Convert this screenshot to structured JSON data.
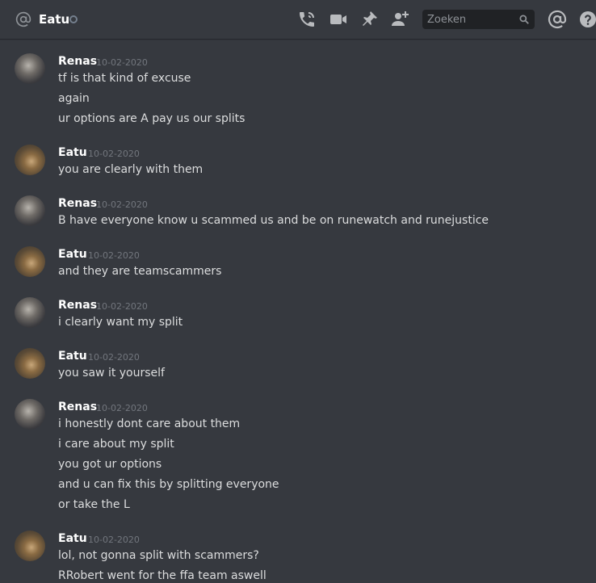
{
  "header": {
    "channel_name": "Eatu",
    "search_placeholder": "Zoeken",
    "colors": {
      "background": "#36393f",
      "text": "#dcddde",
      "muted": "#72767d",
      "icon": "#b9bbbe"
    },
    "icons": [
      "at-icon",
      "phone-icon",
      "video-icon",
      "pin-icon",
      "add-member-icon",
      "search-icon",
      "mention-icon",
      "help-icon"
    ]
  },
  "messages": [
    {
      "author": "Renas",
      "timestamp": "10-02-2020",
      "lines": [
        "tf is that kind of excuse",
        "again",
        "ur options are A pay us our splits"
      ]
    },
    {
      "author": "Eatu",
      "timestamp": "10-02-2020",
      "lines": [
        "you are clearly with them"
      ]
    },
    {
      "author": "Renas",
      "timestamp": "10-02-2020",
      "lines": [
        "B have everyone know u scammed us and be on runewatch and runejustice"
      ]
    },
    {
      "author": "Eatu",
      "timestamp": "10-02-2020",
      "lines": [
        "and they are teamscammers"
      ]
    },
    {
      "author": "Renas",
      "timestamp": "10-02-2020",
      "lines": [
        "i clearly want my split"
      ]
    },
    {
      "author": "Eatu",
      "timestamp": "10-02-2020",
      "lines": [
        "you saw it yourself"
      ]
    },
    {
      "author": "Renas",
      "timestamp": "10-02-2020",
      "lines": [
        "i honestly dont care about them",
        "i care about my split",
        "you got ur options",
        "and u can fix this by splitting everyone",
        "or take the L"
      ]
    },
    {
      "author": "Eatu",
      "timestamp": "10-02-2020",
      "lines": [
        "lol, not gonna split with scammers?",
        "RRobert went for the ffa team aswell"
      ]
    }
  ]
}
